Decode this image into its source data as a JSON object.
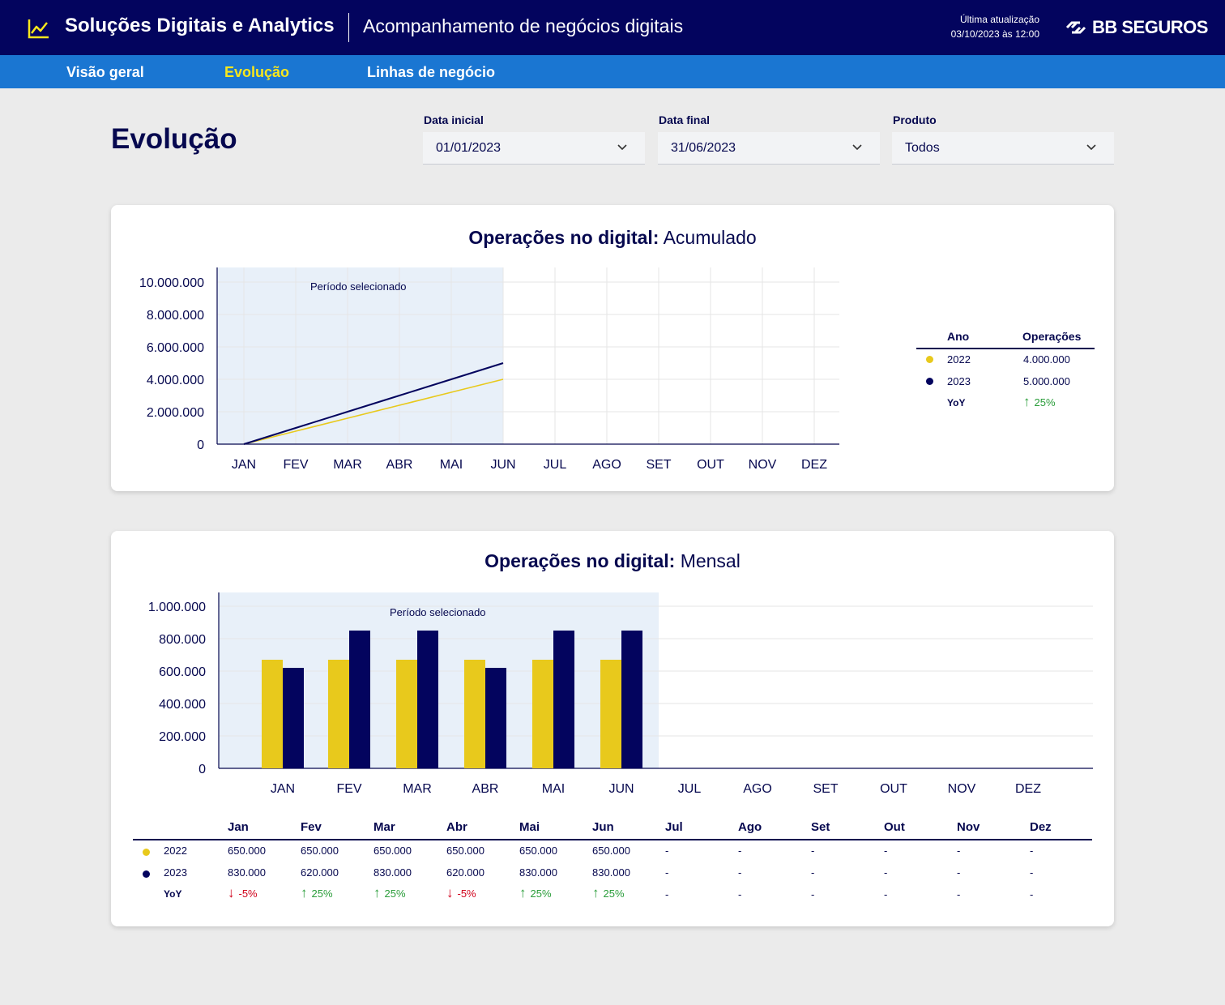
{
  "header": {
    "title": "Soluções Digitais e Analytics",
    "subtitle": "Acompanhamento de negócios digitais",
    "update_label": "Última atualização",
    "update_value": "03/10/2023 às 12:00",
    "brand": "BB SEGUROS"
  },
  "nav": {
    "tabs": [
      {
        "label": "Visão geral",
        "active": false
      },
      {
        "label": "Evolução",
        "active": true
      },
      {
        "label": "Linhas de negócio",
        "active": false
      }
    ]
  },
  "page": {
    "title": "Evolução"
  },
  "filters": [
    {
      "label": "Data inicial",
      "value": "01/01/2023"
    },
    {
      "label": "Data final",
      "value": "31/06/2023"
    },
    {
      "label": "Produto",
      "value": "Todos"
    }
  ],
  "colors": {
    "navy": "#03045e",
    "blue": "#1a76d2",
    "yellow": "#e8c91c",
    "up": "#2a9d3a",
    "down": "#d0021b",
    "highlight": "#e8f0f9"
  },
  "chart_data": [
    {
      "type": "line",
      "title_bold": "Operações no digital:",
      "title_light": "Acumulado",
      "annotation": "Período selecionado",
      "categories": [
        "JAN",
        "FEV",
        "MAR",
        "ABR",
        "MAI",
        "JUN",
        "JUL",
        "AGO",
        "SET",
        "OUT",
        "NOV",
        "DEZ"
      ],
      "highlight_range": [
        "JAN",
        "JUN"
      ],
      "ylim": [
        0,
        10000000
      ],
      "yticks": [
        0,
        2000000,
        4000000,
        6000000,
        8000000,
        10000000
      ],
      "ytick_labels": [
        "0",
        "2.000.000",
        "4.000.000",
        "6.000.000",
        "8.000.000",
        "10.000.000"
      ],
      "series": [
        {
          "name": "2022",
          "color": "#e8c91c",
          "values": [
            0,
            800000,
            1600000,
            2400000,
            3200000,
            4000000
          ]
        },
        {
          "name": "2023",
          "color": "#03045e",
          "values": [
            0,
            1000000,
            2000000,
            3000000,
            4000000,
            5000000
          ]
        }
      ],
      "legend_table": {
        "headers": [
          "Ano",
          "Operações"
        ],
        "rows": [
          {
            "year": "2022",
            "value": "4.000.000",
            "color": "#e8c91c"
          },
          {
            "year": "2023",
            "value": "5.000.000",
            "color": "#03045e"
          }
        ],
        "yoy_label": "YoY",
        "yoy_value": "25%",
        "yoy_dir": "up"
      }
    },
    {
      "type": "bar",
      "title_bold": "Operações no digital:",
      "title_light": "Mensal",
      "annotation": "Período selecionado",
      "categories": [
        "JAN",
        "FEV",
        "MAR",
        "ABR",
        "MAI",
        "JUN",
        "JUL",
        "AGO",
        "SET",
        "OUT",
        "NOV",
        "DEZ"
      ],
      "highlight_range": [
        "JAN",
        "JUN"
      ],
      "ylim": [
        0,
        1000000
      ],
      "yticks": [
        0,
        200000,
        400000,
        600000,
        800000,
        1000000
      ],
      "ytick_labels": [
        "0",
        "200.000",
        "400.000",
        "600.000",
        "800.000",
        "1.000.000"
      ],
      "series": [
        {
          "name": "2022",
          "color": "#e8c91c",
          "values": [
            670000,
            670000,
            670000,
            670000,
            670000,
            670000
          ]
        },
        {
          "name": "2023",
          "color": "#03045e",
          "values": [
            620000,
            850000,
            850000,
            620000,
            850000,
            850000
          ]
        }
      ],
      "table": {
        "months": [
          "Jan",
          "Fev",
          "Mar",
          "Abr",
          "Mai",
          "Jun",
          "Jul",
          "Ago",
          "Set",
          "Out",
          "Nov",
          "Dez"
        ],
        "rows": [
          {
            "year": "2022",
            "color": "#e8c91c",
            "values": [
              "650.000",
              "650.000",
              "650.000",
              "650.000",
              "650.000",
              "650.000",
              "-",
              "-",
              "-",
              "-",
              "-",
              "-"
            ]
          },
          {
            "year": "2023",
            "color": "#03045e",
            "values": [
              "830.000",
              "620.000",
              "830.000",
              "620.000",
              "830.000",
              "830.000",
              "-",
              "-",
              "-",
              "-",
              "-",
              "-"
            ]
          }
        ],
        "yoy_label": "YoY",
        "yoy": [
          {
            "dir": "down",
            "value": "-5%"
          },
          {
            "dir": "up",
            "value": "25%"
          },
          {
            "dir": "up",
            "value": "25%"
          },
          {
            "dir": "down",
            "value": "-5%"
          },
          {
            "dir": "up",
            "value": "25%"
          },
          {
            "dir": "up",
            "value": "25%"
          },
          {
            "dir": "",
            "value": "-"
          },
          {
            "dir": "",
            "value": "-"
          },
          {
            "dir": "",
            "value": "-"
          },
          {
            "dir": "",
            "value": "-"
          },
          {
            "dir": "",
            "value": "-"
          },
          {
            "dir": "",
            "value": "-"
          }
        ]
      }
    }
  ]
}
